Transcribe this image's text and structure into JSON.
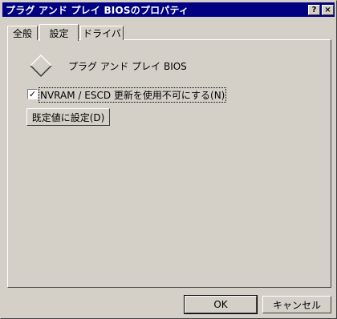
{
  "window": {
    "title": "プラグ アンド プレイ BIOSのプロパティ",
    "help_label": "?",
    "close_label": "×"
  },
  "tabs": [
    {
      "label": "全般"
    },
    {
      "label": "設定"
    },
    {
      "label": "ドライバ"
    }
  ],
  "active_tab": "設定",
  "device": {
    "icon": "diamond-device-icon",
    "name": "プラグ アンド プレイ BIOS"
  },
  "option": {
    "checked": true,
    "check_mark": "✓",
    "label": "NVRAM / ESCD 更新を使用不可にする(N)"
  },
  "buttons": {
    "set_default": "既定値に設定(D)",
    "ok": "OK",
    "cancel": "キャンセル"
  }
}
